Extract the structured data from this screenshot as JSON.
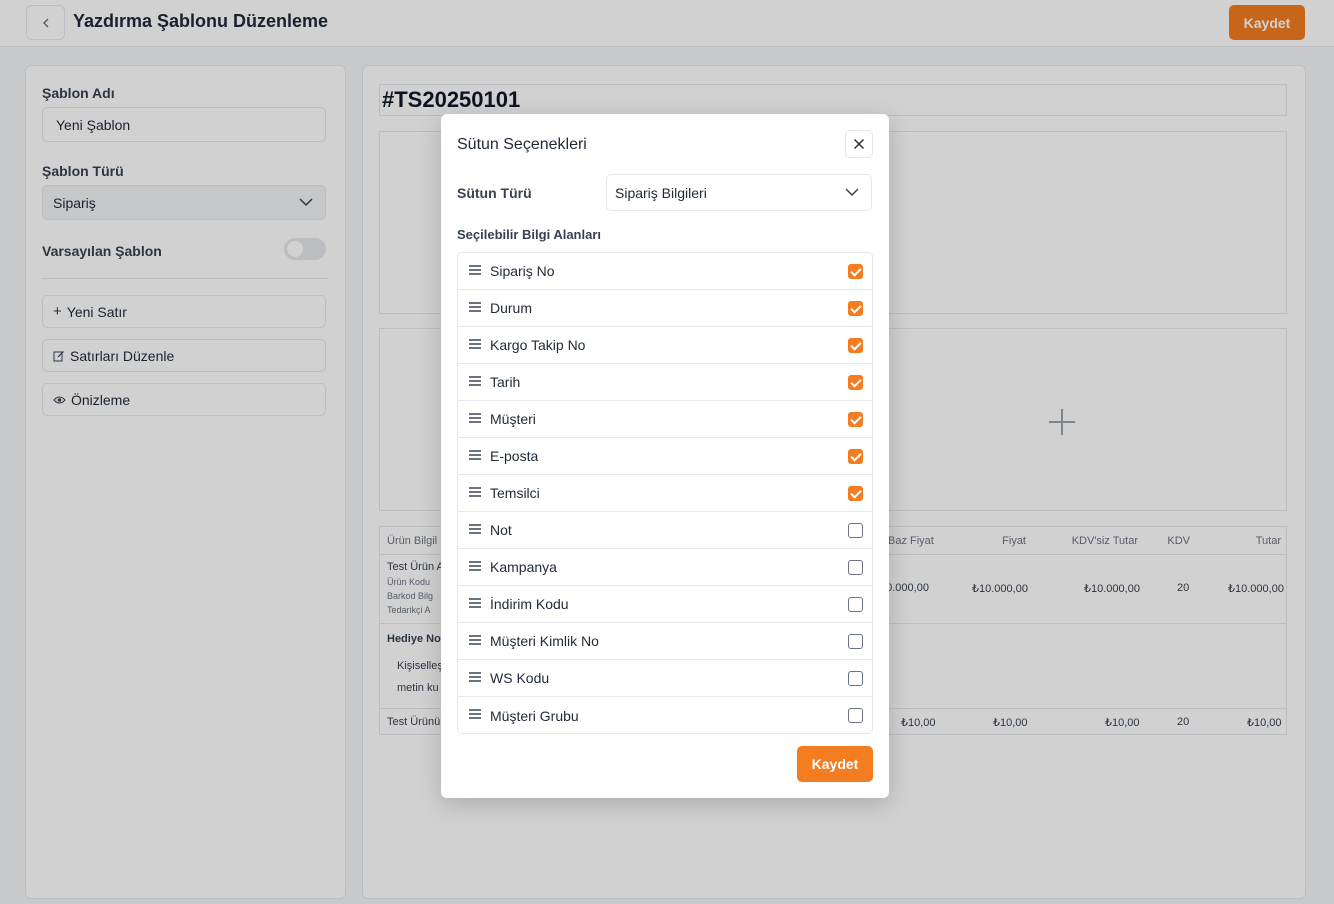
{
  "header": {
    "title": "Yazdırma Şablonu Düzenleme",
    "save_label": "Kaydet"
  },
  "sidebar": {
    "template_name_label": "Şablon Adı",
    "template_name_value": "Yeni Şablon",
    "template_type_label": "Şablon Türü",
    "template_type_value": "Sipariş",
    "default_label": "Varsayılan Şablon",
    "default_on": false,
    "buttons": [
      {
        "icon": "plus-icon",
        "label": "Yeni Satır"
      },
      {
        "icon": "edit-icon",
        "label": "Satırları Düzenle"
      },
      {
        "icon": "eye-icon",
        "label": "Önizleme"
      }
    ]
  },
  "canvas": {
    "doc_no": "#TS20250101",
    "table": {
      "headers": [
        "Ürün Bilgil",
        "Baz Fiyat",
        "Fiyat",
        "KDV'siz Tutar",
        "KDV",
        "Tutar"
      ],
      "row1": {
        "name": "Test Ürün A",
        "sub1": "Ürün Kodu",
        "sub2": "Barkod Bilg",
        "sub3": "Tedarikçi A",
        "base_price": "10.000,00",
        "price": "₺10.000,00",
        "net": "₺10.000,00",
        "kdv": "20",
        "total": "₺10.000,00"
      },
      "gift_title": "Hediye No",
      "gift_line1": "Kişiselleş",
      "gift_line2": "metin ku",
      "row2": {
        "name": "Test Ürünü",
        "base_price": "₺10,00",
        "price": "₺10,00",
        "net": "₺10,00",
        "kdv": "20",
        "total": "₺10,00"
      }
    }
  },
  "modal": {
    "title": "Sütun Seçenekleri",
    "column_type_label": "Sütun Türü",
    "column_type_value": "Sipariş Bilgileri",
    "fields_label": "Seçilebilir Bilgi Alanları",
    "fields": [
      {
        "label": "Sipariş No",
        "checked": true
      },
      {
        "label": "Durum",
        "checked": true
      },
      {
        "label": "Kargo Takip No",
        "checked": true
      },
      {
        "label": "Tarih",
        "checked": true
      },
      {
        "label": "Müşteri",
        "checked": true
      },
      {
        "label": "E-posta",
        "checked": true
      },
      {
        "label": "Temsilci",
        "checked": true
      },
      {
        "label": "Not",
        "checked": false
      },
      {
        "label": "Kampanya",
        "checked": false
      },
      {
        "label": "İndirim Kodu",
        "checked": false
      },
      {
        "label": "Müşteri Kimlik No",
        "checked": false
      },
      {
        "label": "WS Kodu",
        "checked": false
      },
      {
        "label": "Müşteri Grubu",
        "checked": false
      }
    ],
    "save_label": "Kaydet"
  },
  "colors": {
    "accent": "#f37d20"
  }
}
